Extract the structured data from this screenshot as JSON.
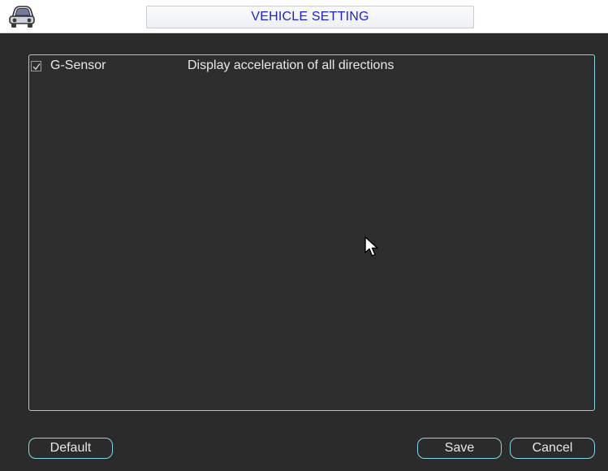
{
  "window": {
    "title": "VEHICLE SETTING",
    "app_icon": "car-icon"
  },
  "content": {
    "rows": [
      {
        "checked": true,
        "label": "G-Sensor",
        "description": "Display acceleration of all directions"
      }
    ]
  },
  "buttons": {
    "default_label": "Default",
    "save_label": "Save",
    "cancel_label": "Cancel"
  },
  "colors": {
    "background": "#2b2b2b",
    "accent_border": "#7fd8e6",
    "title_text": "#1b1fd6",
    "text": "#e8e8e8"
  },
  "cursor": {
    "icon": "mouse-pointer-icon"
  }
}
